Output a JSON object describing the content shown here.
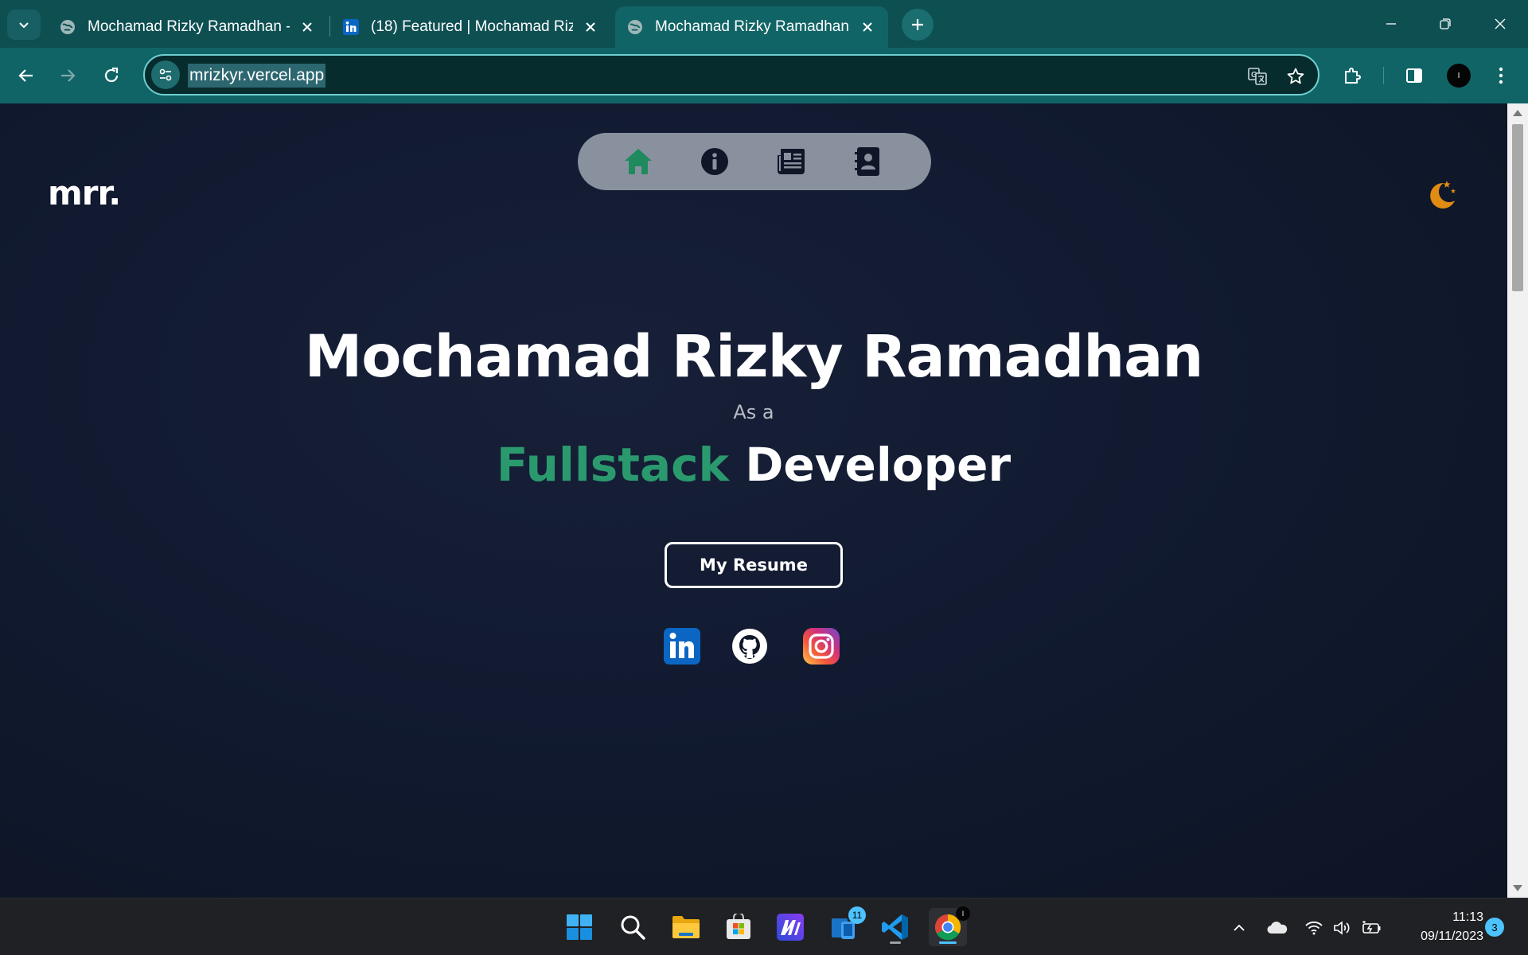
{
  "browser": {
    "tabs": [
      {
        "title": "Mochamad Rizky Ramadhan -",
        "favicon": "globe-icon",
        "active": false
      },
      {
        "title": "(18) Featured | Mochamad Rizk",
        "favicon": "linkedin-icon",
        "active": false
      },
      {
        "title": "Mochamad Rizky Ramadhan -",
        "favicon": "globe-icon",
        "active": true
      }
    ],
    "url": "mrizkyr.vercel.app",
    "profile_initial": "I"
  },
  "site": {
    "logo": "mrr.",
    "nav": [
      {
        "name": "home",
        "icon": "home-icon",
        "active": true
      },
      {
        "name": "about",
        "icon": "info-icon",
        "active": false
      },
      {
        "name": "blog",
        "icon": "newspaper-icon",
        "active": false
      },
      {
        "name": "contact",
        "icon": "address-book-icon",
        "active": false
      }
    ],
    "theme_icon": "moon-stars-icon"
  },
  "hero": {
    "name": "Mochamad Rizky Ramadhan",
    "as_label": "As a",
    "role_accent": "Fullstack",
    "role_rest": "Developer",
    "resume_button": "My Resume",
    "socials": [
      "linkedin-icon",
      "github-icon",
      "instagram-icon"
    ]
  },
  "colors": {
    "accent_green": "#2a9a6e",
    "chrome_teal": "#116466",
    "page_bg": "#111a30",
    "moon_orange": "#e08b12"
  },
  "taskbar": {
    "apps": [
      {
        "name": "start",
        "icon": "windows-icon"
      },
      {
        "name": "search",
        "icon": "search-icon"
      },
      {
        "name": "file-explorer",
        "icon": "folder-icon"
      },
      {
        "name": "store",
        "icon": "store-icon"
      },
      {
        "name": "app-blue",
        "icon": "ma-app-icon"
      },
      {
        "name": "phone-link",
        "icon": "phone-link-icon",
        "badge": "11"
      },
      {
        "name": "vscode",
        "icon": "vscode-icon"
      },
      {
        "name": "chrome",
        "icon": "chrome-icon"
      }
    ],
    "time": "11:13",
    "date": "09/11/2023",
    "notifications": "3"
  }
}
